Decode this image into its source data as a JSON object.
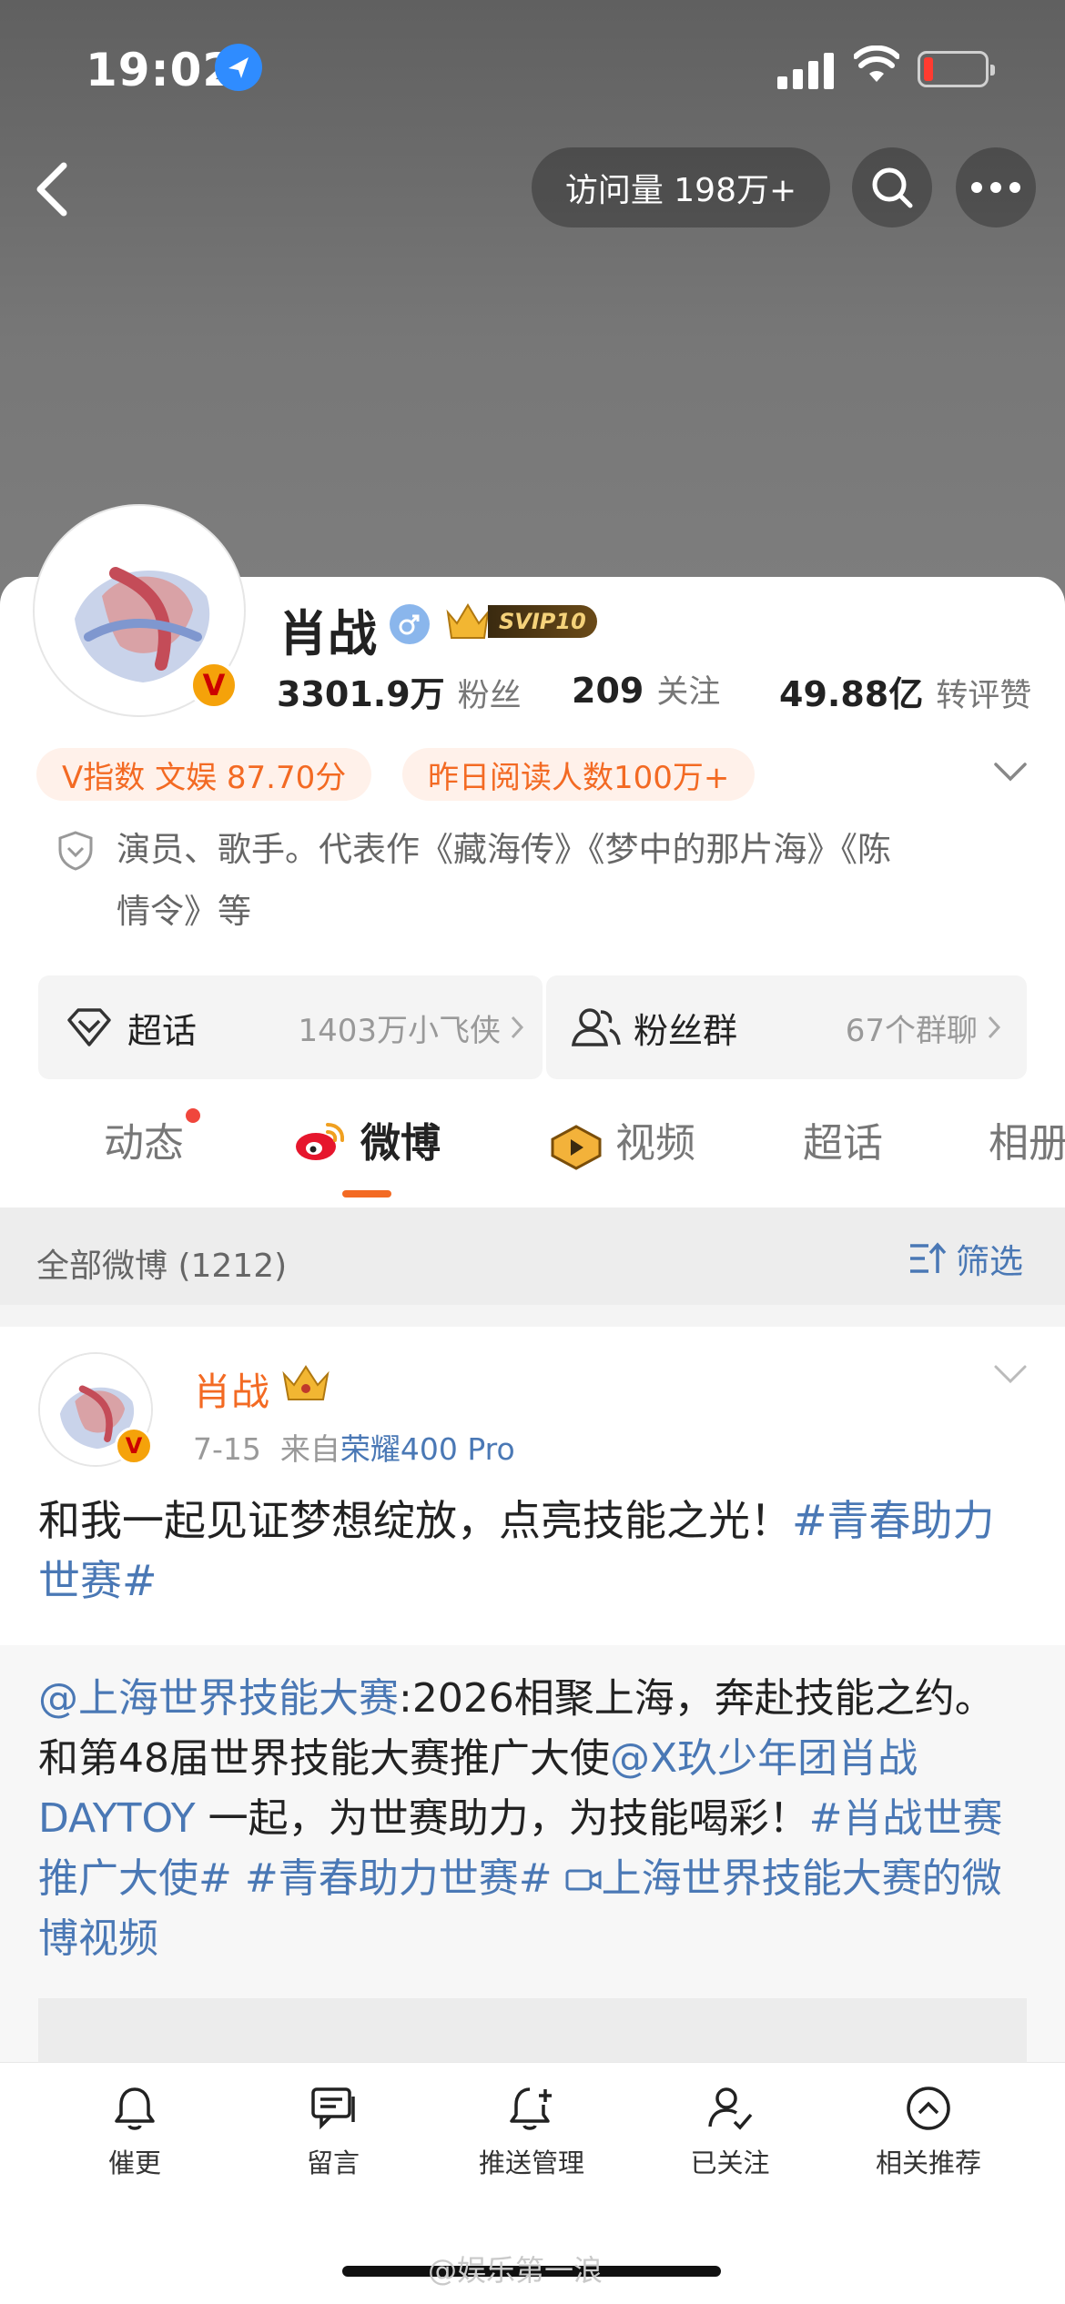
{
  "status_bar": {
    "time": "19:02"
  },
  "header": {
    "visits": "访问量 198万+"
  },
  "profile": {
    "name": "肖战",
    "svip": "SVIP10",
    "stats": [
      {
        "value": "3301.9万",
        "label": "粉丝"
      },
      {
        "value": "209",
        "label": "关注"
      },
      {
        "value": "49.88亿",
        "label": "转评赞"
      }
    ],
    "tags": [
      "V指数 文娱 87.70分",
      "昨日阅读人数100万+"
    ],
    "bio_line1": "演员、歌手。代表作《藏海传》《梦中的那片海》《陈",
    "bio_line2": "情令》等"
  },
  "buttons": {
    "chaohua": {
      "label": "超话",
      "detail": "1403万小飞侠"
    },
    "fans_group": {
      "label": "粉丝群",
      "detail": "67个群聊"
    }
  },
  "tabs": [
    "动态",
    "微博",
    "视频",
    "超话",
    "相册"
  ],
  "section": {
    "all_weibo": "全部微博 (1212)",
    "filter": "筛选"
  },
  "post": {
    "author": "肖战",
    "date": "7-15",
    "from_prefix": "来自",
    "device": "荣耀400 Pro",
    "text": "和我一起见证梦想绽放，点亮技能之光！",
    "hashtag": "#青春助力世赛#",
    "repost": {
      "mention": "@上海世界技能大赛",
      "text1": ":2026相聚上海，奔赴技能之约。和第48届世界技能大赛推广大使",
      "mention2": "@X玖少年团肖战DAYTOY",
      "text2": " 一起，为世赛助力，为技能喝彩！",
      "hashtag1": "#肖战世赛推广大使#",
      "hashtag2": "#青春助力世赛#",
      "video_link": "上海世界技能大赛的微博视频"
    }
  },
  "bottom_nav": [
    "催更",
    "留言",
    "推送管理",
    "已关注",
    "相关推荐"
  ],
  "watermark": "@娱乐第一浪",
  "colors": {
    "accent": "#f36a23",
    "link": "#4a78b5",
    "vip": "#e0a020"
  }
}
